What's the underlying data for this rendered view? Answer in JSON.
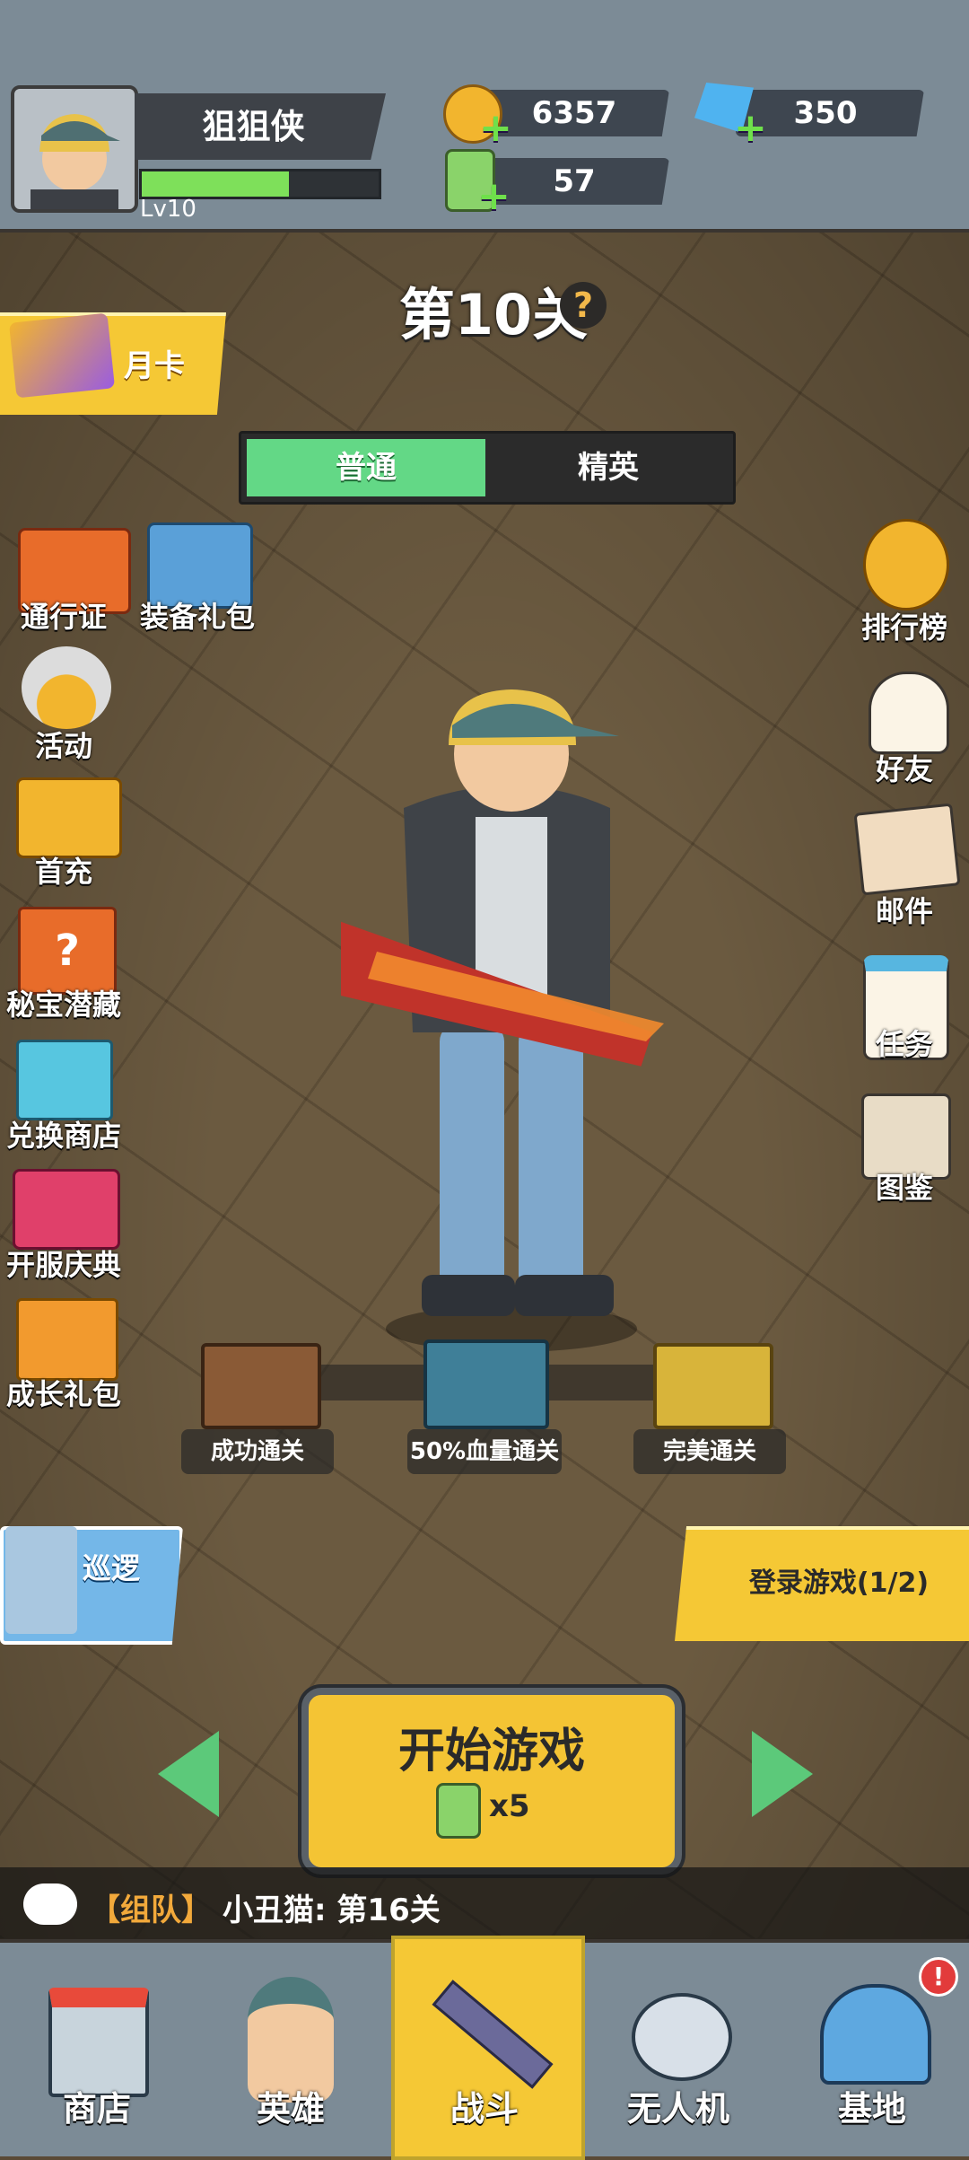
{
  "player": {
    "name": "狙狙侠",
    "level": "Lv10",
    "xp_fraction": 0.62
  },
  "resources": {
    "coins": "6357",
    "gems": "350",
    "energy": "57"
  },
  "stage": {
    "title": "第10关",
    "help": "?"
  },
  "month_card": {
    "label": "月卡"
  },
  "modes": {
    "normal": "普通",
    "elite": "精英"
  },
  "left_menu": [
    {
      "label": "通行证",
      "icon": "gift-box-icon"
    },
    {
      "label": "装备礼包",
      "icon": "gift-shoes-icon"
    },
    {
      "label": "活动",
      "icon": "coin-pile-icon"
    },
    {
      "label": "首充",
      "icon": "treasure-chest-icon"
    },
    {
      "label": "秘宝潜藏",
      "icon": "mystery-box-icon"
    },
    {
      "label": "兑换商店",
      "icon": "shop-icon"
    },
    {
      "label": "开服庆典",
      "icon": "celebration-chest-icon"
    },
    {
      "label": "成长礼包",
      "icon": "growth-gift-icon"
    }
  ],
  "right_menu": [
    {
      "label": "排行榜",
      "icon": "trophy-icon"
    },
    {
      "label": "好友",
      "icon": "friends-icon"
    },
    {
      "label": "邮件",
      "icon": "mail-icon"
    },
    {
      "label": "任务",
      "icon": "tasks-icon"
    },
    {
      "label": "图鉴",
      "icon": "collection-book-icon"
    }
  ],
  "chests": [
    {
      "label": "成功通关"
    },
    {
      "label": "50%血量通关"
    },
    {
      "label": "完美通关"
    }
  ],
  "patrol": {
    "label": "巡逻"
  },
  "login": {
    "label": "登录游戏(1/2)"
  },
  "start": {
    "label": "开始游戏",
    "cost": "x5"
  },
  "chat": {
    "team": "【组队】",
    "message": "小丑猫: 第16关"
  },
  "nav": [
    {
      "label": "商店",
      "icon": "store-icon"
    },
    {
      "label": "英雄",
      "icon": "hero-icon"
    },
    {
      "label": "战斗",
      "icon": "rifle-icon"
    },
    {
      "label": "无人机",
      "icon": "drone-icon"
    },
    {
      "label": "基地",
      "icon": "base-dome-icon"
    }
  ],
  "nav_badge": "!",
  "colors": {
    "accent_yellow": "#f5c835",
    "accent_green": "#63d886",
    "panel_gray": "#7c8b96"
  }
}
